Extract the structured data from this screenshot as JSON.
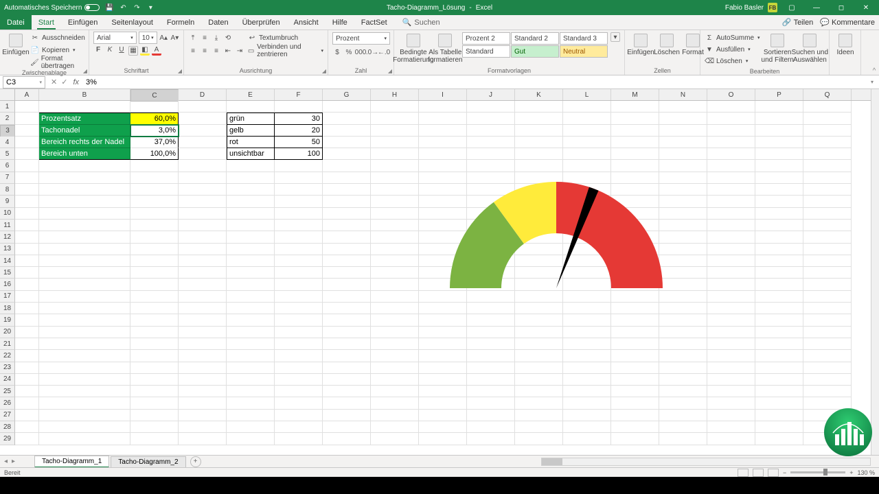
{
  "titlebar": {
    "autosave": "Automatisches Speichern",
    "doc": "Tacho-Diagramm_Lösung",
    "app": "Excel",
    "user": "Fabio Basler",
    "badge": "FB"
  },
  "tabs": {
    "file": "Datei",
    "start": "Start",
    "einfuegen": "Einfügen",
    "seitenlayout": "Seitenlayout",
    "formeln": "Formeln",
    "daten": "Daten",
    "ueberpruefen": "Überprüfen",
    "ansicht": "Ansicht",
    "hilfe": "Hilfe",
    "factset": "FactSet",
    "suchen": "Suchen",
    "teilen": "Teilen",
    "kommentare": "Kommentare"
  },
  "ribbon": {
    "einfuegen": "Einfügen",
    "ausschneiden": "Ausschneiden",
    "kopieren": "Kopieren",
    "format_uebertragen": "Format übertragen",
    "zwischenablage": "Zwischenablage",
    "font_name": "Arial",
    "font_size": "10",
    "schriftart": "Schriftart",
    "textumbruch": "Textumbruch",
    "verbinden": "Verbinden und zentrieren",
    "ausrichtung": "Ausrichtung",
    "numfmt": "Prozent",
    "zahl": "Zahl",
    "bedingte": "Bedingte Formatierung",
    "alstabelle": "Als Tabelle formatieren",
    "style_p2": "Prozent 2",
    "style_s2": "Standard 2",
    "style_s3": "Standard 3",
    "style_std": "Standard",
    "style_gut": "Gut",
    "style_neutral": "Neutral",
    "formatvorlagen": "Formatvorlagen",
    "zeinfuegen": "Einfügen",
    "loeschen": "Löschen",
    "format": "Format",
    "zellen": "Zellen",
    "autosumme": "AutoSumme",
    "ausfuellen": "Ausfüllen",
    "loeschen2": "Löschen",
    "sortieren": "Sortieren und Filtern",
    "suchen": "Suchen und Auswählen",
    "bearbeiten": "Bearbeiten",
    "ideen": "Ideen"
  },
  "fbar": {
    "name": "C3",
    "formula": "3%"
  },
  "cols": [
    "A",
    "B",
    "C",
    "D",
    "E",
    "F",
    "G",
    "H",
    "I",
    "J",
    "K",
    "L",
    "M",
    "N",
    "O",
    "P",
    "Q"
  ],
  "table1": {
    "r1": {
      "b": "Prozentsatz",
      "c": "60,0%"
    },
    "r2": {
      "b": "Tachonadel",
      "c": "3,0%"
    },
    "r3": {
      "b": "Bereich rechts der Nadel",
      "c": "37,0%"
    },
    "r4": {
      "b": "Bereich unten",
      "c": "100,0%"
    }
  },
  "table2": {
    "r1": {
      "e": "grün",
      "f": "30"
    },
    "r2": {
      "e": "gelb",
      "f": "20"
    },
    "r3": {
      "e": "rot",
      "f": "50"
    },
    "r4": {
      "e": "unsichtbar",
      "f": "100"
    }
  },
  "sheets": {
    "s1": "Tacho-Diagramm_1",
    "s2": "Tacho-Diagramm_2"
  },
  "status": {
    "ready": "Bereit",
    "zoom": "130 %"
  },
  "chart_data": {
    "type": "pie",
    "note": "Gauge chart built from two half-donut series",
    "zones": [
      {
        "name": "grün",
        "value": 30,
        "color": "#7cb342"
      },
      {
        "name": "gelb",
        "value": 20,
        "color": "#ffeb3b"
      },
      {
        "name": "rot",
        "value": 50,
        "color": "#e53935"
      },
      {
        "name": "unsichtbar",
        "value": 100,
        "color": "transparent"
      }
    ],
    "needle": [
      {
        "name": "Prozentsatz",
        "value": 60
      },
      {
        "name": "Tachonadel",
        "value": 3
      },
      {
        "name": "Bereich rechts der Nadel",
        "value": 37
      },
      {
        "name": "Bereich unten",
        "value": 100
      }
    ]
  }
}
